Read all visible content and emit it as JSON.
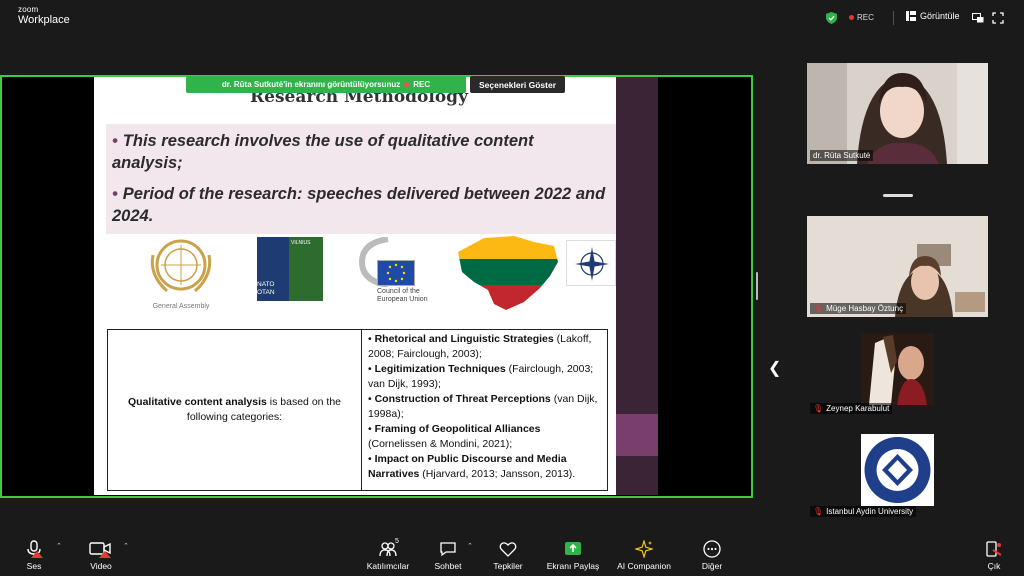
{
  "app": {
    "logo_top": "zoom",
    "logo_bottom": "Workplace"
  },
  "topbar": {
    "rec_label": "REC",
    "view_label": "Görüntüle"
  },
  "share": {
    "banner_text": "dr. Rūta Sutkutė'in ekranını görüntülüyorsunuz",
    "banner_rec": "REC",
    "options_button": "Seçenekleri Göster"
  },
  "slide": {
    "title": "Research Methodology",
    "bullets": [
      "This research involves the use of qualitative content analysis;",
      "Period of the research: speeches delivered between 2022 and 2024."
    ],
    "logos": {
      "un_caption": "General Assembly",
      "nato_left": "NATO OTAN",
      "nato_right": "VILNIUS",
      "eu_caption_1": "Council of the",
      "eu_caption_2": "European Union"
    },
    "table": {
      "left_bold": "Qualitative content analysis",
      "left_rest": " is based on the following categories:",
      "items": [
        {
          "bold": "Rhetorical and Linguistic Strategies",
          "rest": " (Lakoff, 2008; Fairclough, 2003);"
        },
        {
          "bold": "Legitimization Techniques",
          "rest": " (Fairclough, 2003; van Dijk, 1993);"
        },
        {
          "bold": "Construction of Threat Perceptions",
          "rest": " (van Dijk, 1998a);"
        },
        {
          "bold": "Framing of Geopolitical Alliances",
          "rest": " (Cornelissen & Mondini, 2021);"
        },
        {
          "bold": "Impact on Public Discourse and Media Narratives",
          "rest": " (Hjarvard, 2013; Jansson, 2013)."
        }
      ]
    }
  },
  "participants": [
    {
      "name": "dr. Rūta Sutkutė",
      "muted": false
    },
    {
      "name": "Müge Hasbay Öztunç",
      "muted": true
    },
    {
      "name": "Zeynep Karabulut",
      "muted": true
    },
    {
      "name": "Istanbul Aydin University",
      "muted": true
    }
  ],
  "toolbar": {
    "audio": "Ses",
    "video": "Video",
    "participants": "Katılımcılar",
    "participants_count": "5",
    "chat": "Sohbet",
    "reactions": "Tepkiler",
    "share": "Ekranı Paylaş",
    "ai": "AI Companion",
    "more": "Diğer",
    "leave": "Çık"
  },
  "colors": {
    "share_border": "#3ecc3e",
    "banner_green": "#2fb34a",
    "accent_purple": "#7a3e6c",
    "leave_red": "#e53935"
  }
}
